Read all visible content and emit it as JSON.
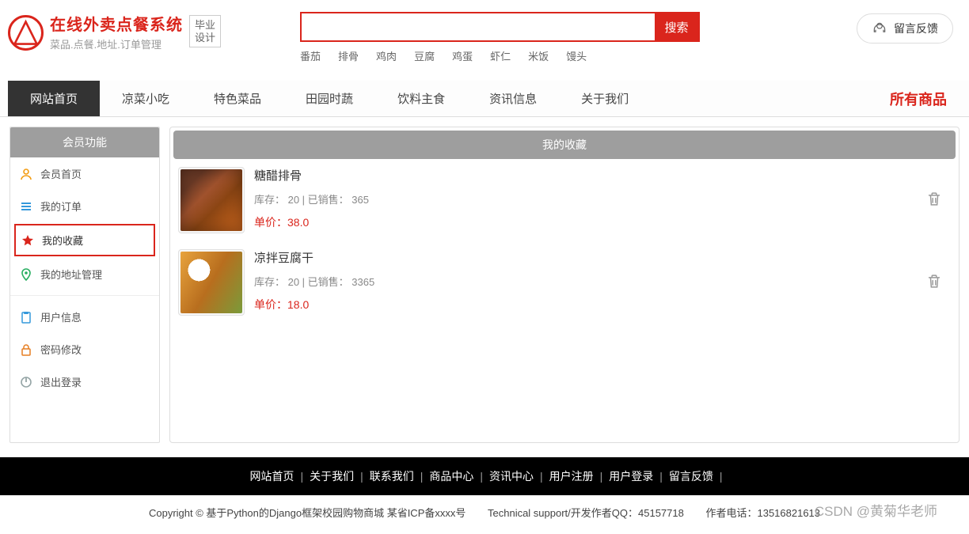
{
  "header": {
    "title": "在线外卖点餐系统",
    "subtitle": "菜品.点餐.地址.订单管理",
    "badge": "毕业\n设计",
    "search_btn": "搜索",
    "search_placeholder": "",
    "hot_words": [
      "番茄",
      "排骨",
      "鸡肉",
      "豆腐",
      "鸡蛋",
      "虾仁",
      "米饭",
      "馒头"
    ],
    "feedback": "留言反馈"
  },
  "nav": {
    "items": [
      "网站首页",
      "凉菜小吃",
      "特色菜品",
      "田园时蔬",
      "饮料主食",
      "资讯信息",
      "关于我们"
    ],
    "active_index": 0,
    "all_products": "所有商品"
  },
  "sidebar": {
    "title": "会员功能",
    "group1": [
      {
        "label": "会员首页",
        "icon": "user",
        "color": "#f39c12"
      },
      {
        "label": "我的订单",
        "icon": "list",
        "color": "#3498db"
      },
      {
        "label": "我的收藏",
        "icon": "star",
        "color": "#da251c",
        "active": true
      },
      {
        "label": "我的地址管理",
        "icon": "location",
        "color": "#27ae60"
      }
    ],
    "group2": [
      {
        "label": "用户信息",
        "icon": "clipboard",
        "color": "#3498db"
      },
      {
        "label": "密码修改",
        "icon": "lock",
        "color": "#e67e22"
      },
      {
        "label": "退出登录",
        "icon": "power",
        "color": "#95a5a6"
      }
    ]
  },
  "main": {
    "title": "我的收藏",
    "stock_label": "库存：",
    "sold_label": "已销售：",
    "price_label": "单价：",
    "items": [
      {
        "name": "糖醋排骨",
        "stock": "20",
        "sold": "365",
        "price": "38.0",
        "img": "ribs"
      },
      {
        "name": "凉拌豆腐干",
        "stock": "20",
        "sold": "3365",
        "price": "18.0",
        "img": "tofu"
      }
    ]
  },
  "footer": {
    "links": [
      "网站首页",
      "关于我们",
      "联系我们",
      "商品中心",
      "资讯中心",
      "用户注册",
      "用户登录",
      "留言反馈"
    ]
  },
  "copyright": {
    "text1": "Copyright © 基于Python的Django框架校园购物商城 某省ICP备xxxx号",
    "text2": "Technical support/开发作者QQ：45157718",
    "text3": "作者电话：13516821613",
    "watermark": "CSDN @黄菊华老师"
  }
}
